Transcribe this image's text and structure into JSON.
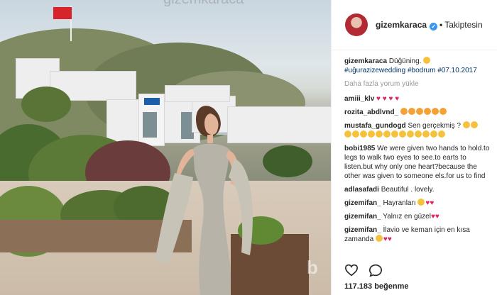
{
  "post": {
    "username": "gizemkaraca",
    "follow_status": "Takiptesin",
    "caption": "Düğüning.",
    "hashtags": "#uğurazizewedding #bodrum #07.10.2017",
    "load_more": "Daha fazla yorum yükle",
    "likes": "117.183 beğenme",
    "watermark_top": "gizemkaraca",
    "watermark_br": "b",
    "accent_color": "#3897f0",
    "heart_color": "#e0245e"
  },
  "comments": [
    {
      "user": "amiii_klv",
      "text": "",
      "emoji": "red-heart x4"
    },
    {
      "user": "rozita_abdlvnd_",
      "text": "",
      "emoji": "heart-eyes x6"
    },
    {
      "user": "mustafa_gundogd",
      "text": "Sen gerçekmiş ?",
      "emoji": "thumbs-up x2, thumbs-up x13"
    },
    {
      "user": "bobi1985",
      "text": "We were given two hands to hold.to legs to walk two eyes to see.to earts to listen.but why only one heart?because the other was given to someone els.for us to find"
    },
    {
      "user": "adlasafadi",
      "text": "Beautiful . lovely."
    },
    {
      "user": "gizemifan_",
      "text": "Hayranları",
      "emoji": "face, red-heart x2"
    },
    {
      "user": "gizemifan_",
      "text": "Yalnız en güzel",
      "emoji": "red-heart x2"
    },
    {
      "user": "gizemifan_",
      "text": "İlavio ve keman için en kısa zamanda",
      "emoji": "face, red-heart x2"
    }
  ]
}
